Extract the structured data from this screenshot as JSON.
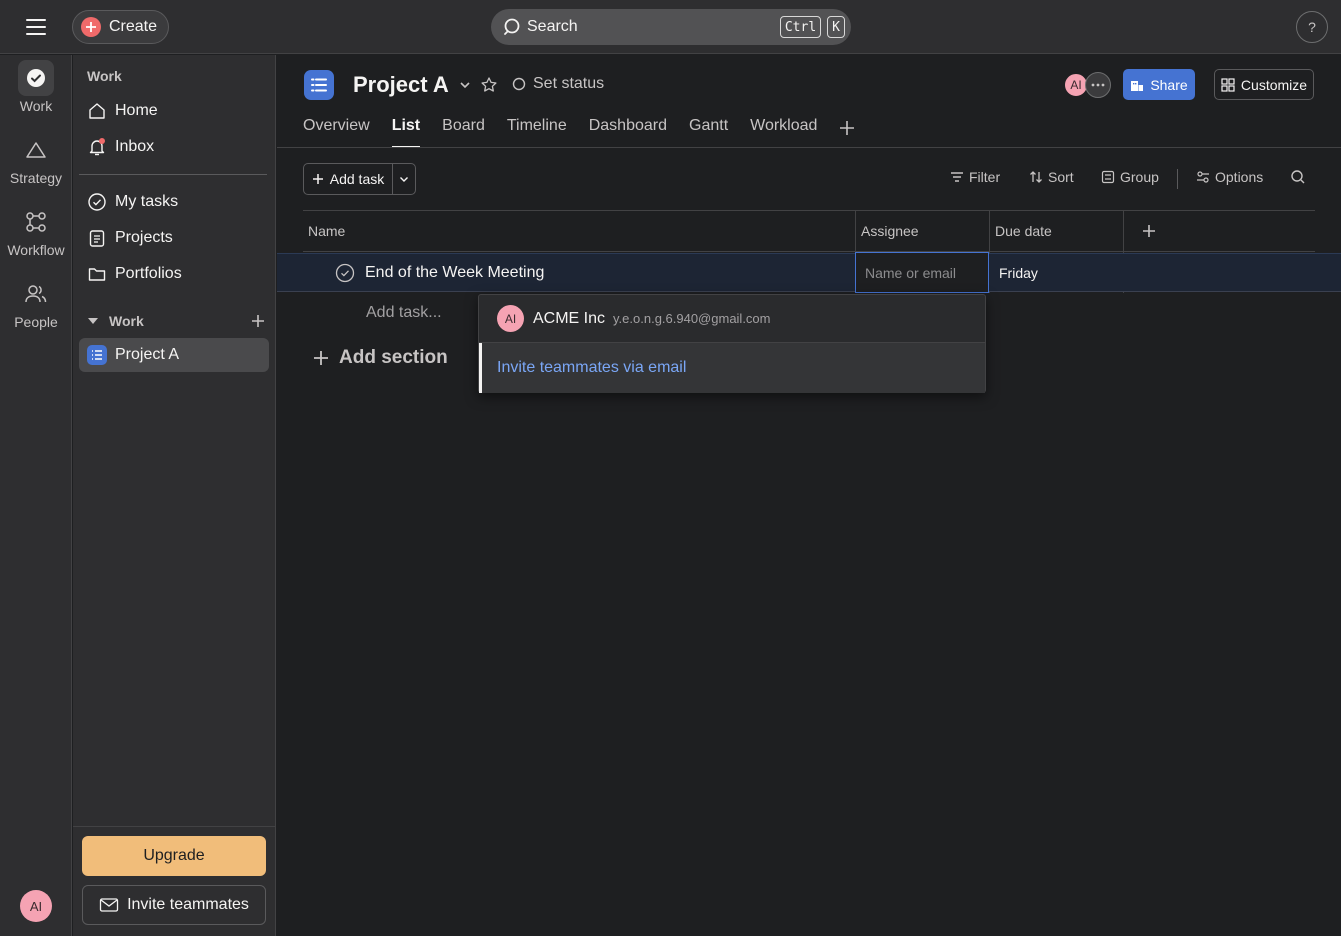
{
  "topbar": {
    "create_label": "Create",
    "search_label": "Search",
    "shortcut_keys": [
      "Ctrl",
      "K"
    ],
    "help_label": "?"
  },
  "rail": {
    "items": [
      {
        "label": "Work",
        "icon": "check-circle-icon",
        "active": true
      },
      {
        "label": "Strategy",
        "icon": "triangle-icon"
      },
      {
        "label": "Workflow",
        "icon": "workflow-icon"
      },
      {
        "label": "People",
        "icon": "people-icon"
      }
    ],
    "avatar_initials": "AI"
  },
  "sidebar": {
    "heading": "Work",
    "items": [
      {
        "label": "Home",
        "icon": "home-icon"
      },
      {
        "label": "Inbox",
        "icon": "bell-icon",
        "notification": true
      },
      {
        "label": "My tasks",
        "icon": "check-circle-icon"
      },
      {
        "label": "Projects",
        "icon": "clipboard-icon"
      },
      {
        "label": "Portfolios",
        "icon": "folder-icon"
      }
    ],
    "section_label": "Work",
    "projects": [
      {
        "label": "Project A",
        "active": true
      }
    ],
    "upgrade_label": "Upgrade",
    "invite_label": "Invite teammates"
  },
  "project": {
    "title": "Project A",
    "status_label": "Set status",
    "member_initials": "AI",
    "share_label": "Share",
    "customize_label": "Customize",
    "tabs": [
      {
        "label": "Overview"
      },
      {
        "label": "List",
        "active": true
      },
      {
        "label": "Board"
      },
      {
        "label": "Timeline"
      },
      {
        "label": "Dashboard"
      },
      {
        "label": "Gantt"
      },
      {
        "label": "Workload"
      }
    ]
  },
  "toolbar": {
    "add_task_label": "Add task",
    "filter_label": "Filter",
    "sort_label": "Sort",
    "group_label": "Group",
    "options_label": "Options"
  },
  "table": {
    "columns": [
      "Name",
      "Assignee",
      "Due date"
    ],
    "rows": [
      {
        "name": "End of the Week Meeting",
        "assignee_placeholder": "Name or email",
        "due": "Friday"
      }
    ],
    "add_task_label": "Add task...",
    "add_section_label": "Add section"
  },
  "assignee_dropdown": {
    "user_initials": "AI",
    "user_name": "ACME Inc",
    "user_email": "y.e.o.n.g.6.940@gmail.com",
    "invite_label": "Invite teammates via email"
  },
  "colors": {
    "background": "#1e1f21",
    "panel": "#2e2e30",
    "accent_blue": "#4573d2",
    "create_red": "#f06a6a",
    "upgrade_orange": "#f1bd7a",
    "avatar_pink": "#f5a3b3"
  }
}
